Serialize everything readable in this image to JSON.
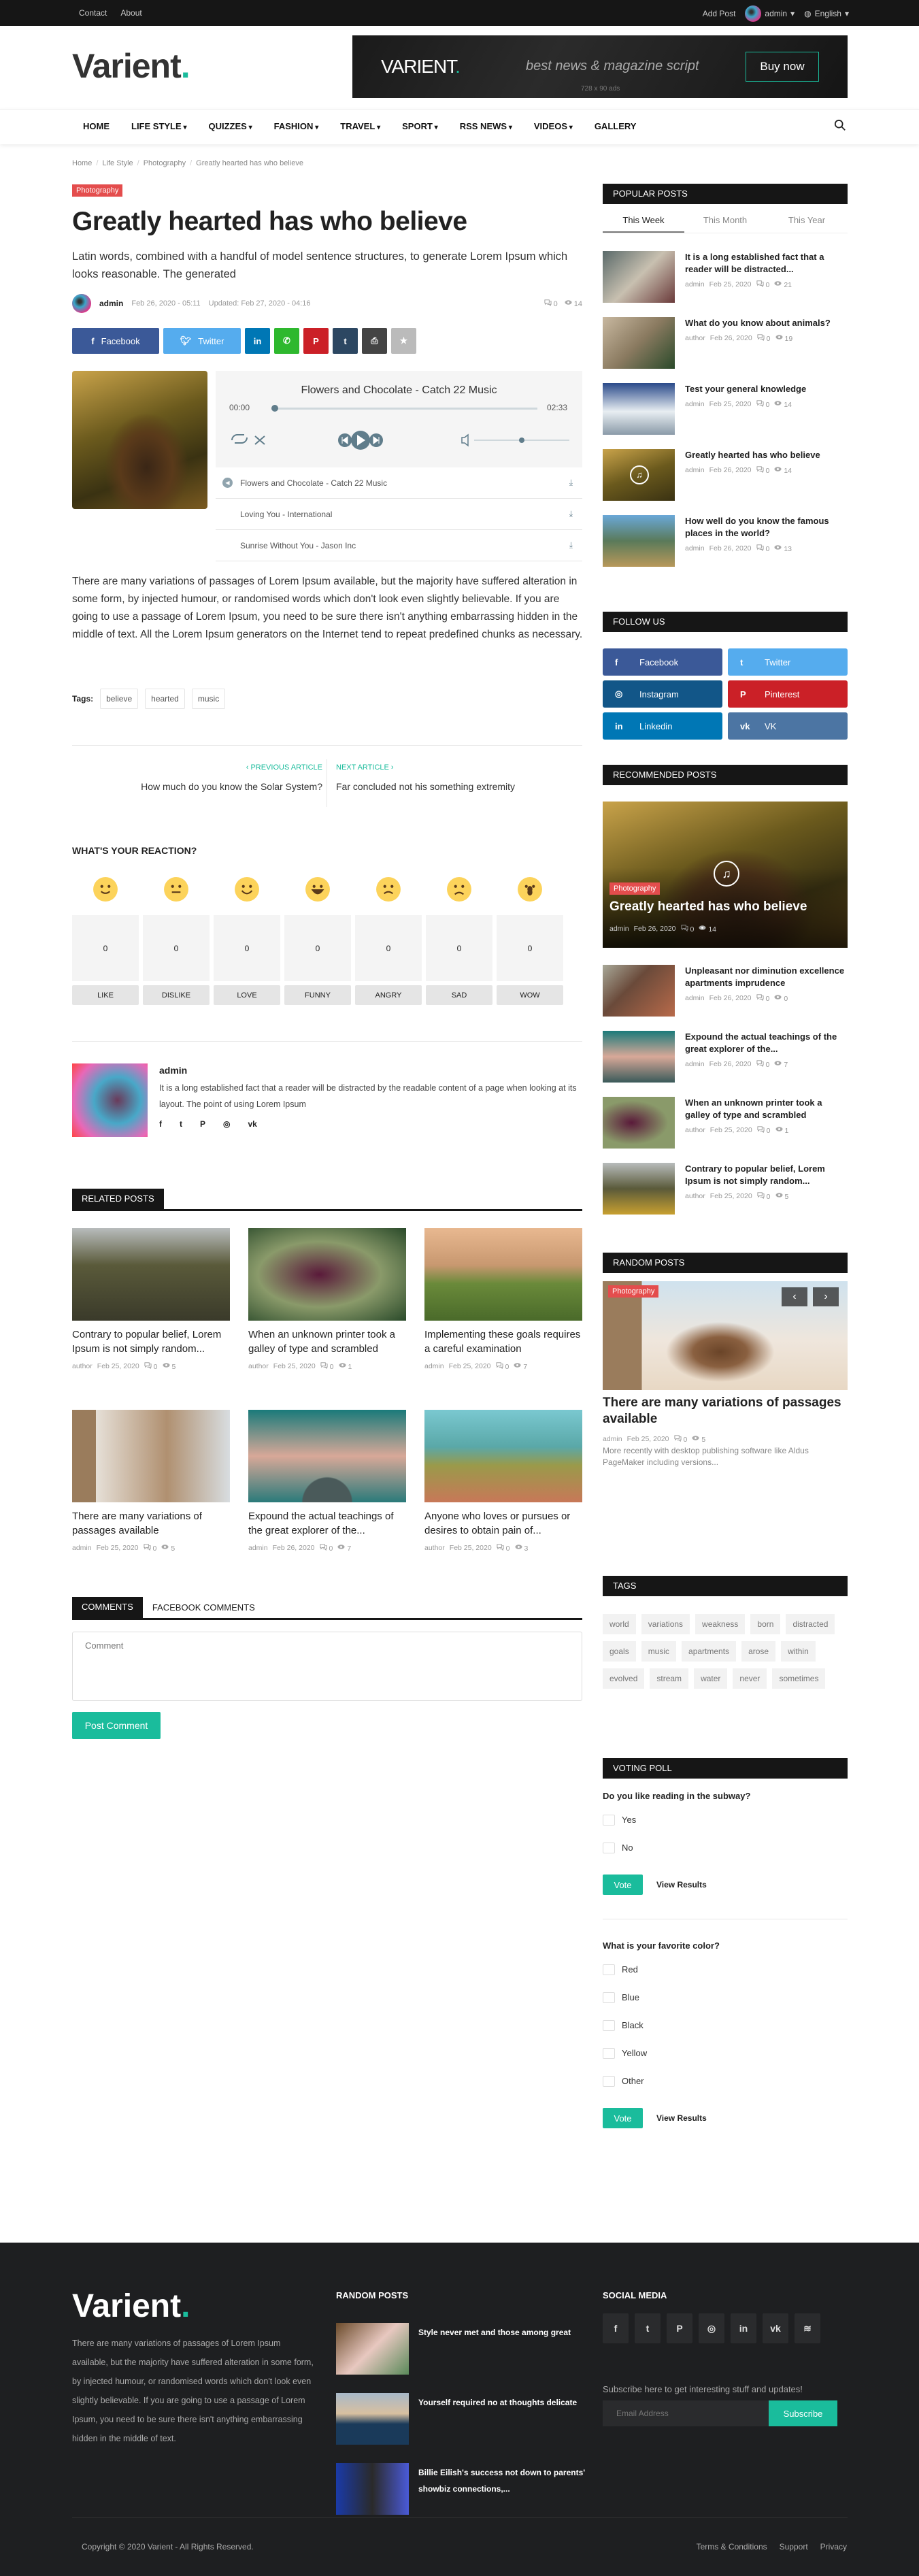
{
  "colors": {
    "accent": "#1abc9c",
    "category": "#e44d4d",
    "dark": "#161616"
  },
  "topbar": {
    "links": [
      "Contact",
      "About"
    ],
    "add_post": "Add Post",
    "user": "admin",
    "language": "English"
  },
  "header": {
    "logo": "Varient",
    "logo_dot": ".",
    "ad": {
      "brand": "VARIENT",
      "brand_dot": ".",
      "tagline": "best news & magazine script",
      "cta": "Buy now",
      "size": "728 x 90 ads"
    }
  },
  "nav": {
    "items": [
      {
        "label": "HOME",
        "dropdown": false
      },
      {
        "label": "LIFE STYLE",
        "dropdown": true
      },
      {
        "label": "QUIZZES",
        "dropdown": true
      },
      {
        "label": "FASHION",
        "dropdown": true
      },
      {
        "label": "TRAVEL",
        "dropdown": true
      },
      {
        "label": "SPORT",
        "dropdown": true
      },
      {
        "label": "RSS NEWS",
        "dropdown": true
      },
      {
        "label": "VIDEOS",
        "dropdown": true
      },
      {
        "label": "GALLERY",
        "dropdown": false
      }
    ]
  },
  "breadcrumb": [
    "Home",
    "Life Style",
    "Photography",
    "Greatly hearted has who believe"
  ],
  "post": {
    "category": "Photography",
    "title": "Greatly hearted has who believe",
    "summary": "Latin words, combined with a handful of model sentence structures, to generate Lorem Ipsum which looks reasonable. The generated",
    "author": "admin",
    "date": "Feb 26, 2020 - 05:11",
    "updated": "Updated: Feb 27, 2020 - 04:16",
    "comments": "0",
    "views": "14",
    "share": {
      "facebook": "Facebook",
      "twitter": "Twitter"
    },
    "player": {
      "now_playing": "Flowers and Chocolate - Catch 22 Music",
      "current_time": "00:00",
      "duration": "02:33",
      "progress": 0,
      "volume": 0.5,
      "playlist": [
        "Flowers and Chocolate - Catch 22 Music",
        "Loving You - International",
        "Sunrise Without You - Jason Inc"
      ]
    },
    "body": "There are many variations of passages of Lorem Ipsum available, but the majority have suffered alteration in some form, by injected humour, or randomised words which don't look even slightly believable. If you are going to use a passage of Lorem Ipsum, you need to be sure there isn't anything embarrassing hidden in the middle of text. All the Lorem Ipsum generators on the Internet tend to repeat predefined chunks as necessary.",
    "tags_label": "Tags:",
    "tags": [
      "believe",
      "hearted",
      "music"
    ],
    "prev": {
      "label": "PREVIOUS ARTICLE",
      "title": "How much do you know the Solar System?"
    },
    "next": {
      "label": "NEXT ARTICLE",
      "title": "Far concluded not his something extremity"
    }
  },
  "reactions": {
    "title": "WHAT'S YOUR REACTION?",
    "items": [
      {
        "label": "LIKE",
        "count": "0"
      },
      {
        "label": "DISLIKE",
        "count": "0"
      },
      {
        "label": "LOVE",
        "count": "0"
      },
      {
        "label": "FUNNY",
        "count": "0"
      },
      {
        "label": "ANGRY",
        "count": "0"
      },
      {
        "label": "SAD",
        "count": "0"
      },
      {
        "label": "WOW",
        "count": "0"
      }
    ]
  },
  "author_box": {
    "name": "admin",
    "bio": "It is a long established fact that a reader will be distracted by the readable content of a page when looking at its layout. The point of using Lorem Ipsum"
  },
  "related": {
    "title": "RELATED POSTS",
    "posts": [
      {
        "title": "Contrary to popular belief, Lorem Ipsum is not simply random...",
        "author": "author",
        "date": "Feb 25, 2020",
        "comments": "0",
        "views": "5"
      },
      {
        "title": "When an unknown printer took a galley of type and scrambled",
        "author": "author",
        "date": "Feb 25, 2020",
        "comments": "0",
        "views": "1"
      },
      {
        "title": "Implementing these goals requires a careful examination",
        "author": "admin",
        "date": "Feb 25, 2020",
        "comments": "0",
        "views": "7"
      },
      {
        "title": "There are many variations of passages available",
        "author": "admin",
        "date": "Feb 25, 2020",
        "comments": "0",
        "views": "5"
      },
      {
        "title": "Expound the actual teachings of the great explorer of the...",
        "author": "admin",
        "date": "Feb 26, 2020",
        "comments": "0",
        "views": "7"
      },
      {
        "title": "Anyone who loves or pursues or desires to obtain pain of...",
        "author": "author",
        "date": "Feb 25, 2020",
        "comments": "0",
        "views": "3"
      }
    ]
  },
  "comments": {
    "tabs": [
      "COMMENTS",
      "FACEBOOK COMMENTS"
    ],
    "placeholder": "Comment",
    "submit": "Post Comment"
  },
  "sidebar": {
    "popular": {
      "title": "POPULAR POSTS",
      "tabs": [
        "This Week",
        "This Month",
        "This Year"
      ],
      "posts": [
        {
          "title": "It is a long established fact that a reader will be distracted...",
          "author": "admin",
          "date": "Feb 25, 2020",
          "comments": "0",
          "views": "21"
        },
        {
          "title": "What do you know about animals?",
          "author": "author",
          "date": "Feb 26, 2020",
          "comments": "0",
          "views": "19"
        },
        {
          "title": "Test your general knowledge",
          "author": "admin",
          "date": "Feb 25, 2020",
          "comments": "0",
          "views": "14"
        },
        {
          "title": "Greatly hearted has who believe",
          "author": "admin",
          "date": "Feb 26, 2020",
          "comments": "0",
          "views": "14"
        },
        {
          "title": "How well do you know the famous places in the world?",
          "author": "admin",
          "date": "Feb 26, 2020",
          "comments": "0",
          "views": "13"
        }
      ]
    },
    "follow": {
      "title": "FOLLOW US",
      "buttons": [
        {
          "label": "Facebook",
          "icon": "f",
          "color": "#3b5998"
        },
        {
          "label": "Twitter",
          "icon": "t",
          "color": "#55acee"
        },
        {
          "label": "Instagram",
          "icon": "◎",
          "color": "#125688"
        },
        {
          "label": "Pinterest",
          "icon": "P",
          "color": "#cb2027"
        },
        {
          "label": "Linkedin",
          "icon": "in",
          "color": "#0077b5"
        },
        {
          "label": "VK",
          "icon": "vk",
          "color": "#4c75a3"
        }
      ]
    },
    "recommended": {
      "title": "RECOMMENDED POSTS",
      "featured": {
        "category": "Photography",
        "title": "Greatly hearted has who believe",
        "author": "admin",
        "date": "Feb 26, 2020",
        "comments": "0",
        "views": "14"
      },
      "posts": [
        {
          "title": "Unpleasant nor diminution excellence apartments imprudence",
          "author": "admin",
          "date": "Feb 26, 2020",
          "comments": "0",
          "views": "0"
        },
        {
          "title": "Expound the actual teachings of the great explorer of the...",
          "author": "admin",
          "date": "Feb 26, 2020",
          "comments": "0",
          "views": "7"
        },
        {
          "title": "When an unknown printer took a galley of type and scrambled",
          "author": "author",
          "date": "Feb 25, 2020",
          "comments": "0",
          "views": "1"
        },
        {
          "title": "Contrary to popular belief, Lorem Ipsum is not simply random...",
          "author": "author",
          "date": "Feb 25, 2020",
          "comments": "0",
          "views": "5"
        }
      ]
    },
    "random": {
      "title": "RANDOM POSTS",
      "category": "Photography",
      "post_title": "There are many variations of passages available",
      "author": "admin",
      "date": "Feb 25, 2020",
      "comments": "0",
      "views": "5",
      "excerpt": "More recently with desktop publishing software like Aldus PageMaker including versions..."
    },
    "tags": {
      "title": "TAGS",
      "items": [
        "world",
        "variations",
        "weakness",
        "born",
        "distracted",
        "goals",
        "music",
        "apartments",
        "arose",
        "within",
        "evolved",
        "stream",
        "water",
        "never",
        "sometimes"
      ]
    },
    "poll": {
      "title": "VOTING POLL",
      "vote": "Vote",
      "results": "View Results",
      "questions": [
        {
          "question": "Do you like reading in the subway?",
          "options": [
            "Yes",
            "No"
          ]
        },
        {
          "question": "What is your favorite color?",
          "options": [
            "Red",
            "Blue",
            "Black",
            "Yellow",
            "Other"
          ]
        }
      ]
    }
  },
  "footer": {
    "logo": "Varient",
    "logo_dot": ".",
    "about": "There are many variations of passages of Lorem Ipsum available, but the majority have suffered alteration in some form, by injected humour, or randomised words which don't look even slightly believable. If you are going to use a passage of Lorem Ipsum, you need to be sure there isn't anything embarrassing hidden in the middle of text.",
    "random_title": "RANDOM POSTS",
    "random_posts": [
      "Style never met and those among great",
      "Yourself required no at thoughts delicate",
      "Billie Eilish's success not down to parents' showbiz connections,..."
    ],
    "social_title": "SOCIAL MEDIA",
    "social_icons": [
      "f",
      "t",
      "P",
      "◎",
      "in",
      "vk",
      "≋"
    ],
    "subscribe_text": "Subscribe here to get interesting stuff and updates!",
    "email_placeholder": "Email Address",
    "subscribe": "Subscribe",
    "copyright": "Copyright © 2020 Varient - All Rights Reserved.",
    "links": [
      "Terms & Conditions",
      "Support",
      "Privacy"
    ]
  }
}
